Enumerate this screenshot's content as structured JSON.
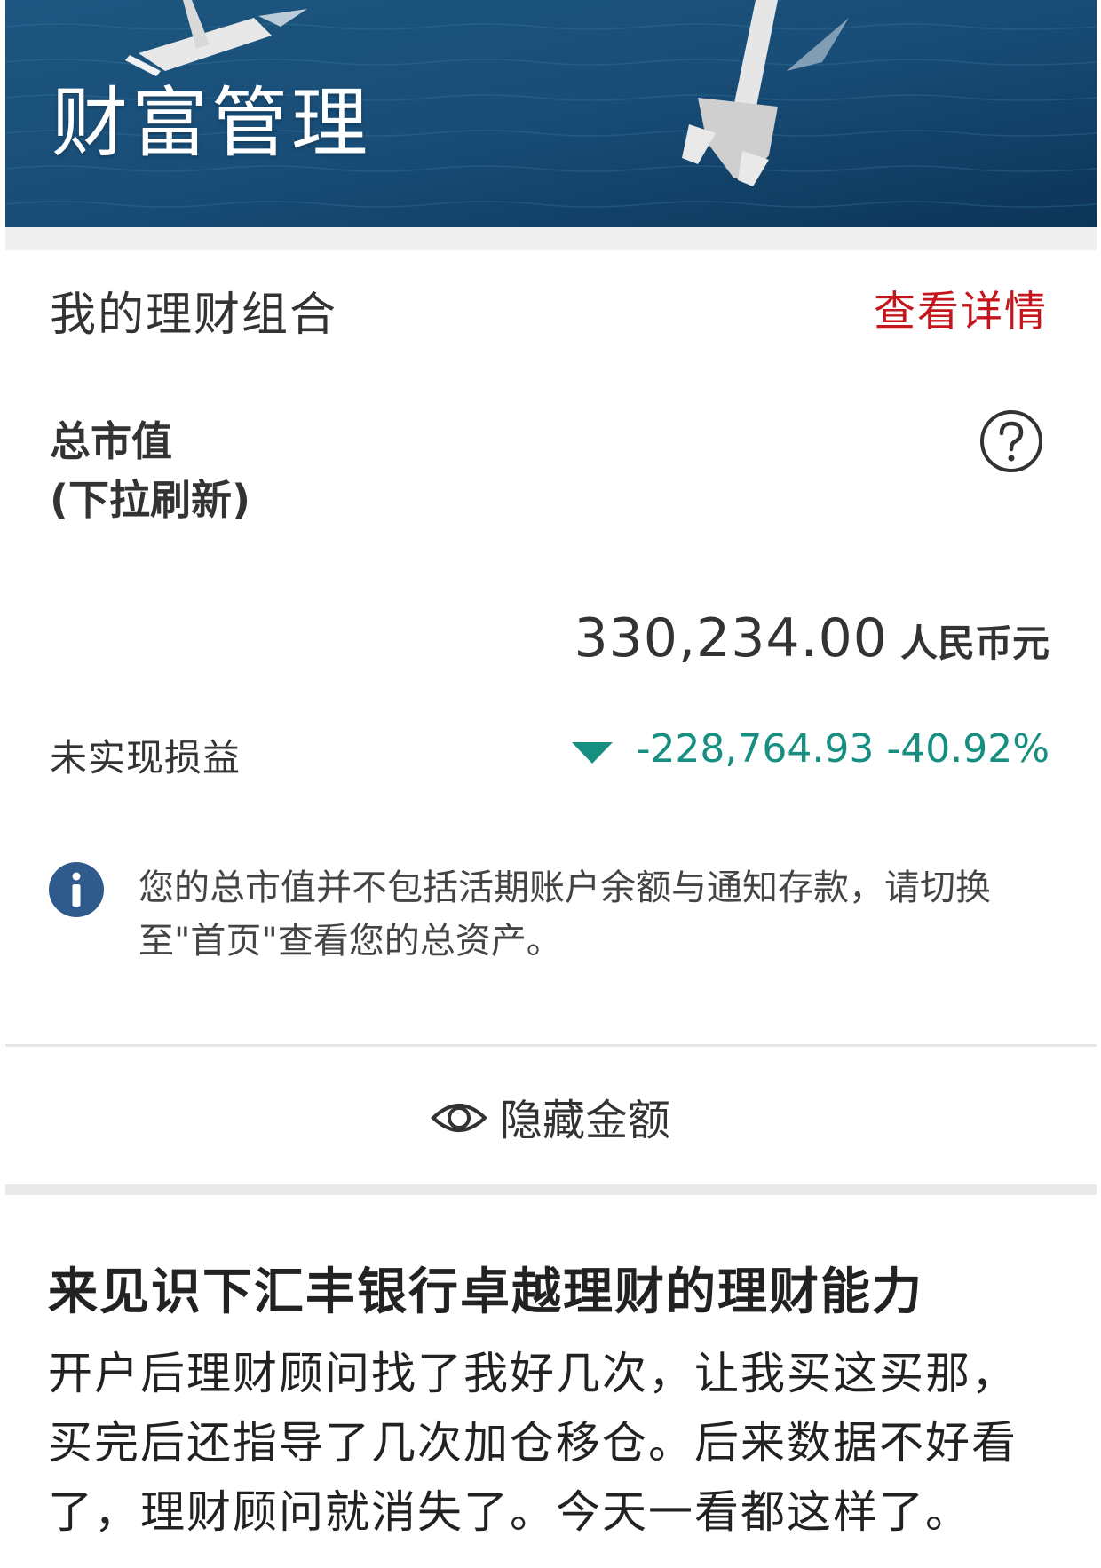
{
  "hero": {
    "title": "财富管理"
  },
  "portfolio": {
    "header": "我的理财组合",
    "details_link": "查看详情",
    "market_value_label_line1": "总市值",
    "market_value_label_line2": "(下拉刷新)",
    "amount": "330,234.00",
    "currency": "人民币元",
    "unrealized_label": "未实现损益",
    "unrealized_value": "-228,764.93 -40.92%",
    "info_text": "您的总市值并不包括活期账户余额与通知存款，请切换至\"首页\"查看您的总资产。",
    "hide_amount_label": "隐藏金额"
  },
  "post": {
    "title": "来见识下汇丰银行卓越理财的理财能力",
    "body": "开户后理财顾问找了我好几次，让我买这买那，买完后还指导了几次加仓移仓。后来数据不好看了，理财顾问就消失了。今天一看都这样了。"
  },
  "colors": {
    "accent_red": "#c4161c",
    "loss_teal": "#168f80",
    "info_blue": "#2e5a8c"
  },
  "icons": {
    "help": "question-circle-icon",
    "info": "info-circle-icon",
    "eye": "eye-icon",
    "down_arrow": "triangle-down-icon"
  }
}
